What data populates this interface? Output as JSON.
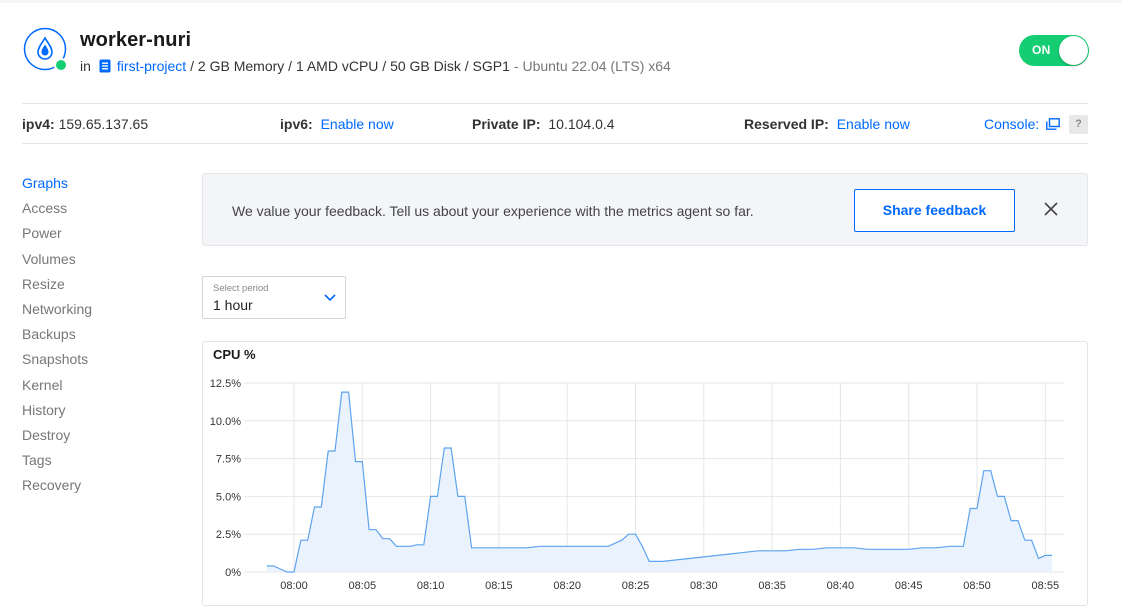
{
  "droplet": {
    "name": "worker-nuri",
    "project_prefix": "in",
    "project": "first-project",
    "specs": "/ 2 GB Memory / 1 AMD vCPU / 50 GB Disk / SGP1",
    "os": "- Ubuntu 22.04 (LTS) x64",
    "status_label": "ON",
    "status_color": "#15cd72",
    "icon": "droplet-icon"
  },
  "network": {
    "ipv4_label": "ipv4:",
    "ipv4_value": "159.65.137.65",
    "ipv6_label": "ipv6:",
    "ipv6_action": "Enable now",
    "private_label": "Private IP:",
    "private_value": "10.104.0.4",
    "reserved_label": "Reserved IP:",
    "reserved_action": "Enable now",
    "console_label": "Console:",
    "help_label": "?"
  },
  "sidebar": {
    "items": [
      {
        "label": "Graphs",
        "active": true
      },
      {
        "label": "Access"
      },
      {
        "label": "Power"
      },
      {
        "label": "Volumes"
      },
      {
        "label": "Resize"
      },
      {
        "label": "Networking"
      },
      {
        "label": "Backups"
      },
      {
        "label": "Snapshots"
      },
      {
        "label": "Kernel"
      },
      {
        "label": "History"
      },
      {
        "label": "Destroy"
      },
      {
        "label": "Tags"
      },
      {
        "label": "Recovery"
      }
    ]
  },
  "feedback": {
    "message": "We value your feedback. Tell us about your experience with the metrics agent so far.",
    "button": "Share feedback"
  },
  "period": {
    "label": "Select period",
    "value": "1 hour"
  },
  "colors": {
    "accent": "#0069ff",
    "line": "#5da3ef",
    "fill": "#eaf3fd"
  },
  "chart_data": {
    "type": "area",
    "title": "CPU %",
    "ylim": [
      0,
      12.5
    ],
    "yticks": [
      "0%",
      "2.5%",
      "5.0%",
      "7.5%",
      "10.0%",
      "12.5%"
    ],
    "xticks": [
      "08:00",
      "08:05",
      "08:10",
      "08:15",
      "08:20",
      "08:25",
      "08:30",
      "08:35",
      "08:40",
      "08:45",
      "08:50",
      "08:55"
    ],
    "grid": true,
    "series": [
      {
        "minutes_after_0800": [
          -2,
          -1.5,
          -1,
          -0.5,
          0,
          0.5,
          1,
          1.5,
          2,
          2.5,
          3,
          3.5,
          4,
          4.5,
          5,
          5.5,
          6,
          6.5,
          7,
          7.5,
          8,
          8.5,
          9,
          9.5,
          10,
          10.5,
          11,
          11.5,
          12,
          12.5,
          13,
          14,
          15,
          16,
          17,
          18,
          19,
          20,
          21,
          22,
          23,
          24,
          24.5,
          25,
          25.5,
          26,
          27,
          28,
          29,
          30,
          31,
          32,
          33,
          34,
          35,
          36,
          37,
          38,
          39,
          40,
          41,
          42,
          43,
          44,
          45,
          46,
          47,
          48,
          49,
          49.5,
          50,
          50.5,
          51,
          51.5,
          52,
          52.5,
          53,
          53.5,
          54,
          54.5,
          55,
          55.5
        ],
        "values": [
          0.4,
          0.4,
          0.2,
          0,
          0,
          2.1,
          2.1,
          4.3,
          4.3,
          8.0,
          8.0,
          11.9,
          11.9,
          7.3,
          7.3,
          2.8,
          2.8,
          2.2,
          2.2,
          1.7,
          1.7,
          1.7,
          1.8,
          1.8,
          5.0,
          5.0,
          8.2,
          8.2,
          5.0,
          5.0,
          1.6,
          1.6,
          1.6,
          1.6,
          1.6,
          1.7,
          1.7,
          1.7,
          1.7,
          1.7,
          1.7,
          2.1,
          2.5,
          2.5,
          1.7,
          0.7,
          0.7,
          0.8,
          0.9,
          1.0,
          1.1,
          1.2,
          1.3,
          1.4,
          1.4,
          1.4,
          1.5,
          1.5,
          1.6,
          1.6,
          1.6,
          1.5,
          1.5,
          1.5,
          1.5,
          1.6,
          1.6,
          1.7,
          1.7,
          4.2,
          4.2,
          6.7,
          6.7,
          5.0,
          5.0,
          3.4,
          3.4,
          2.1,
          2.1,
          0.9,
          1.1,
          1.1
        ]
      }
    ]
  }
}
